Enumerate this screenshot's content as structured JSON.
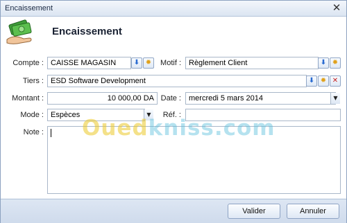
{
  "window": {
    "title": "Encaissement",
    "close_glyph": "✕"
  },
  "header": {
    "title": "Encaissement",
    "icon": "money-hand-icon"
  },
  "form": {
    "compte": {
      "label": "Compte :",
      "value": "CAISSE MAGASIN"
    },
    "motif": {
      "label": "Motif :",
      "value": "Règlement Client"
    },
    "tiers": {
      "label": "Tiers :",
      "value": "ESD Software Development"
    },
    "montant": {
      "label": "Montant :",
      "value": "10 000,00 DA"
    },
    "date": {
      "label": "Date :",
      "value": "mercredi 5 mars 2014"
    },
    "mode": {
      "label": "Mode :",
      "value": "Espèces"
    },
    "ref": {
      "label": "Réf. :",
      "value": ""
    },
    "note": {
      "label": "Note :",
      "value": ""
    }
  },
  "icons": {
    "download": "⬇",
    "gear": "✹",
    "delete": "✕",
    "dropdown": "▼"
  },
  "buttons": {
    "validate": "Valider",
    "cancel": "Annuler"
  },
  "watermark": {
    "part1": "Oued",
    "part2": "kniss.com"
  }
}
